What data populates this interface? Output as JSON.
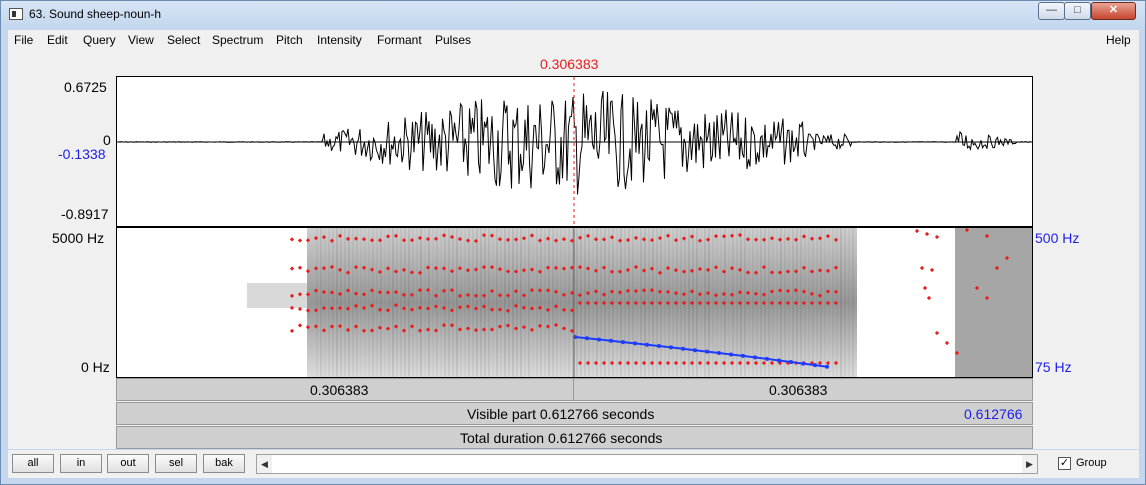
{
  "window": {
    "title": "63. Sound sheep-noun-h",
    "minimize": "—",
    "maximize": "□",
    "close": "✕"
  },
  "menu": [
    "File",
    "Edit",
    "Query",
    "View",
    "Select",
    "Spectrum",
    "Pitch",
    "Intensity",
    "Formant",
    "Pulses",
    "Help"
  ],
  "cursor_time": "0.306383",
  "waveform": {
    "max": "0.6725",
    "zero": "0",
    "cursor_value": "-0.1338",
    "min": "-0.8917"
  },
  "spectrogram": {
    "freq_top": "5000 Hz",
    "freq_bottom": "0 Hz",
    "pitch_top": "500 Hz",
    "pitch_bottom": "75 Hz"
  },
  "time_bar": {
    "left_segment": "0.306383",
    "right_segment": "0.306383"
  },
  "visible_bar": {
    "start": "0",
    "text": "Visible part 0.612766 seconds",
    "end": "0.612766"
  },
  "total_bar": {
    "text": "Total duration 0.612766 seconds"
  },
  "buttons": {
    "all": "all",
    "in": "in",
    "out": "out",
    "sel": "sel",
    "bak": "bak"
  },
  "group": {
    "label": "Group",
    "checked": true,
    "mark": "✓"
  },
  "colors": {
    "cursor": "#e61e1e",
    "pitch": "#1e3cff",
    "formant": "#e61e1e",
    "axis_blue": "#1e1ee6"
  }
}
